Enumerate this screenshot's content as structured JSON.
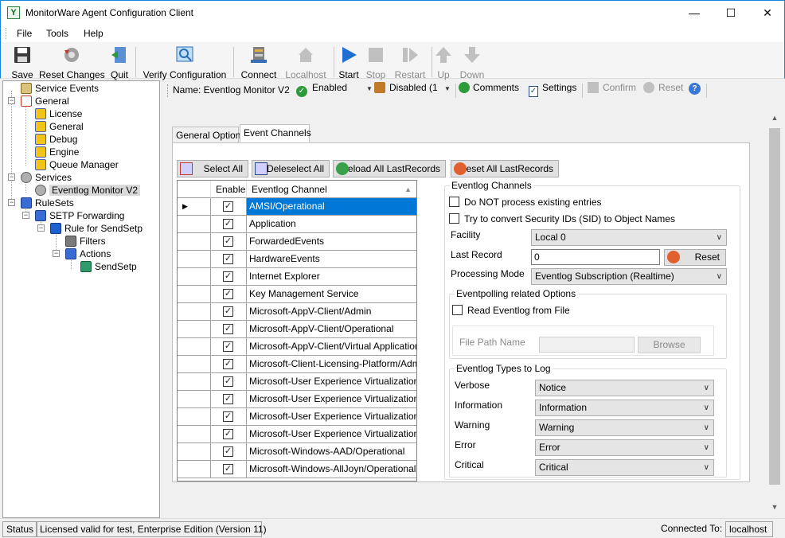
{
  "window": {
    "title": "MonitorWare Agent Configuration Client"
  },
  "menu": [
    "File",
    "Tools",
    "Help"
  ],
  "toolbar": {
    "save": "Save",
    "reset_changes": "Reset Changes",
    "quit": "Quit",
    "verify": "Verify Configuration",
    "connect": "Connect",
    "localhost": "Localhost",
    "start": "Start",
    "stop": "Stop",
    "restart": "Restart",
    "up": "Up",
    "down": "Down"
  },
  "tree": {
    "service_events": "Service Events",
    "general": "General",
    "license": "License",
    "general_sub": "General",
    "debug": "Debug",
    "engine": "Engine",
    "queue_manager": "Queue Manager",
    "services": "Services",
    "eventlog_monitor": "Eventlog Monitor V2",
    "rulesets": "RuleSets",
    "setp_forwarding": "SETP Forwarding",
    "rule_for_sendsetp": "Rule for SendSetp",
    "filters": "Filters",
    "actions": "Actions",
    "sendsetp": "SendSetp"
  },
  "namebar": {
    "name": "Name: Eventlog Monitor V2",
    "enabled": "Enabled",
    "disabled": "Disabled (1",
    "comments": "Comments",
    "settings": "Settings",
    "confirm": "Confirm",
    "reset": "Reset"
  },
  "tabs": [
    "General Options",
    "Event Channels"
  ],
  "buttons": {
    "select_all": "Select All",
    "deselect_all": "Deleselect All",
    "reload_all": "Reload All LastRecords",
    "reset_all": "Reset All LastRecords"
  },
  "grid": {
    "headers": [
      "Enable",
      "Eventlog Channel"
    ],
    "rows": [
      "AMSI/Operational",
      "Application",
      "ForwardedEvents",
      "HardwareEvents",
      "Internet Explorer",
      "Key Management Service",
      "Microsoft-AppV-Client/Admin",
      "Microsoft-AppV-Client/Operational",
      "Microsoft-AppV-Client/Virtual Applications",
      "Microsoft-Client-Licensing-Platform/Admin",
      "Microsoft-User Experience Virtualization-A...",
      "Microsoft-User Experience Virtualization-A...",
      "Microsoft-User Experience Virtualization-I...",
      "Microsoft-User Experience Virtualization-S...",
      "Microsoft-Windows-AAD/Operational",
      "Microsoft-Windows-AllJoyn/Operational"
    ]
  },
  "channels_group": {
    "title": "Eventlog Channels",
    "do_not_process": "Do NOT process existing entries",
    "convert_sid": "Try to convert Security IDs (SID) to Object Names",
    "facility_label": "Facility",
    "facility_value": "Local 0",
    "last_record_label": "Last Record",
    "last_record_value": "0",
    "reset_button": "Reset",
    "processing_label": "Processing Mode",
    "processing_value": "Eventlog Subscription (Realtime)"
  },
  "polling_group": {
    "title": "Eventpolling related Options",
    "read_from_file": "Read Eventlog from File",
    "file_path_label": "File  Path Name",
    "file_path_value": "",
    "browse": "Browse"
  },
  "types_group": {
    "title": "Eventlog Types to Log",
    "verbose_label": "Verbose",
    "verbose_value": "Notice",
    "information_label": "Information",
    "information_value": "Information",
    "warning_label": "Warning",
    "warning_value": "Warning",
    "error_label": "Error",
    "error_value": "Error",
    "critical_label": "Critical",
    "critical_value": "Critical"
  },
  "status": {
    "status": "Status",
    "license": "Licensed valid for test, Enterprise Edition (Version 11)",
    "connected_label": "Connected To:",
    "connected_value": "localhost"
  }
}
